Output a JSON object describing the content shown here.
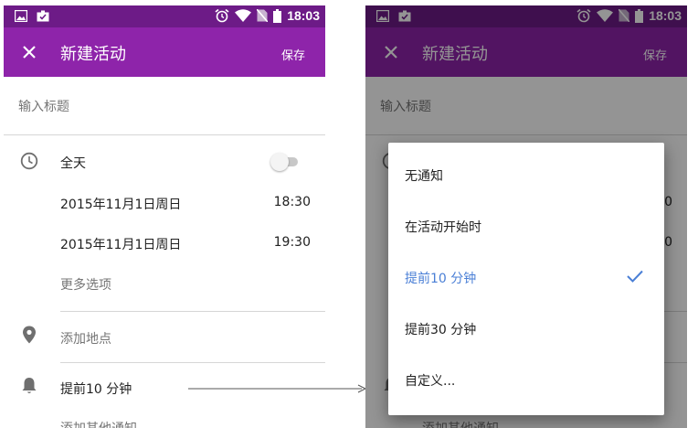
{
  "status_bar": {
    "time": "18:03"
  },
  "app_bar": {
    "title": "新建活动",
    "save_label": "保存"
  },
  "form": {
    "title_placeholder": "输入标题",
    "all_day_label": "全天",
    "all_day_enabled": false,
    "start_date": "2015年11月1日周日",
    "start_time": "18:30",
    "end_date": "2015年11月1日周日",
    "end_time": "19:30",
    "more_options": "更多选项",
    "add_location": "添加地点",
    "notification": "提前10 分钟",
    "add_other_notification": "添加其他通知",
    "partial_time_1": "0",
    "partial_time_2": "0"
  },
  "notification_dialog": {
    "options": [
      {
        "label": "无通知",
        "selected": false
      },
      {
        "label": "在活动开始时",
        "selected": false
      },
      {
        "label": "提前10 分钟",
        "selected": true
      },
      {
        "label": "提前30 分钟",
        "selected": false
      },
      {
        "label": "自定义...",
        "selected": false
      }
    ],
    "check_color": "#4a7fd6"
  },
  "colors": {
    "status_bar": "#6d1b87",
    "app_bar": "#8e24aa",
    "accent": "#4a7fd6"
  },
  "icons": {
    "status_left": [
      "image-icon",
      "briefcase-check-icon"
    ],
    "status_right": [
      "alarm-icon",
      "wifi-icon",
      "no-sim-icon",
      "battery-icon"
    ],
    "form": [
      "clock-icon",
      "location-pin-icon",
      "bell-icon"
    ],
    "app_bar": "close-icon",
    "selected": "checkmark-icon"
  }
}
